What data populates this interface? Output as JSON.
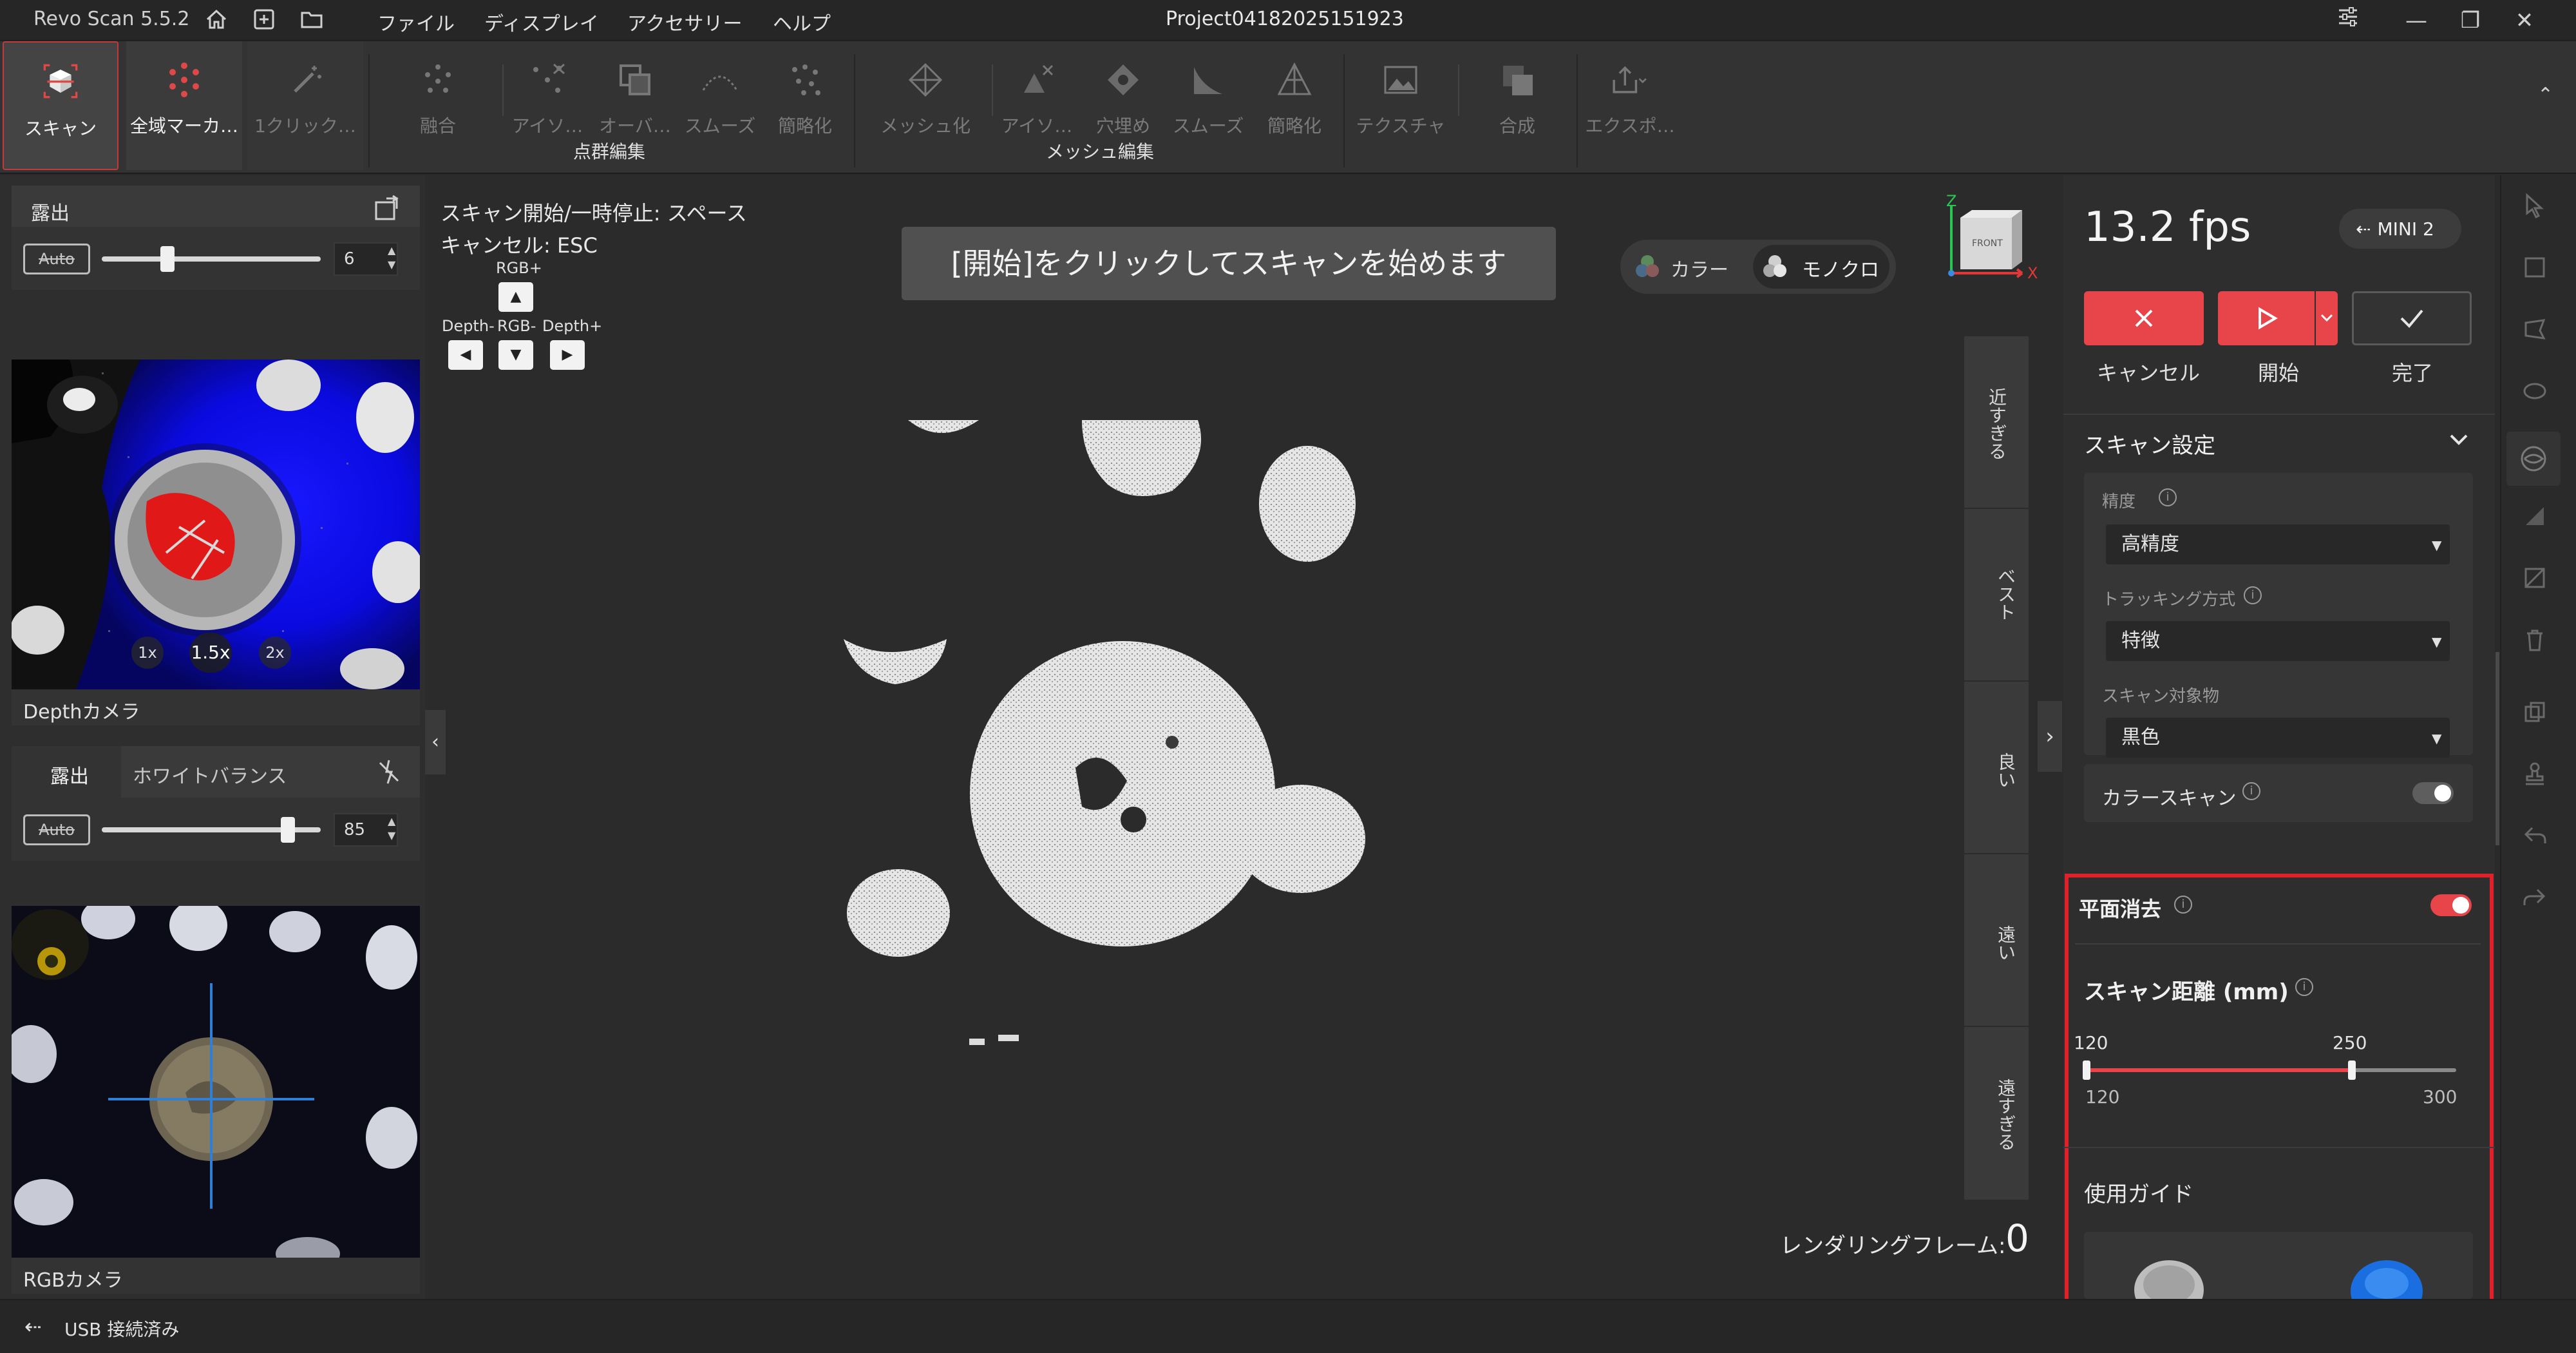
{
  "app": {
    "title": "Revo Scan 5.5.2",
    "project": "Project04182025151923"
  },
  "menu": [
    "ファイル",
    "ディスプレイ",
    "アクセサリー",
    "ヘルプ"
  ],
  "toolbar": {
    "scan": "スキャン",
    "global_marker": "全域マーカ…",
    "one_click": "1クリック…",
    "fuse": "融合",
    "isolate1": "アイソ…",
    "overlap": "オーバ…",
    "smooth1": "スムーズ",
    "simplify1": "簡略化",
    "mesh": "メッシュ化",
    "isolate2": "アイソ…",
    "fill": "穴埋め",
    "smooth2": "スムーズ",
    "simplify2": "簡略化",
    "texture": "テクスチャ",
    "merge": "合成",
    "export": "エクスポ…",
    "group_pointcloud": "点群編集",
    "group_mesh": "メッシュ編集"
  },
  "left": {
    "exposure_title": "露出",
    "auto": "Auto",
    "depth_exposure": "6",
    "depth_exposure_level": 0.3,
    "depth_camera": "Depthカメラ",
    "zoom": [
      "1x",
      "1.5x",
      "2x"
    ],
    "tab_exposure": "露出",
    "tab_wb": "ホワイトバランス",
    "rgb_exposure": "85",
    "rgb_exposure_level": 0.85,
    "rgb_camera": "RGBカメラ"
  },
  "viewport": {
    "hint_line1": "スキャン開始/一時停止: スペース",
    "hint_line2": "キャンセル: ESC",
    "rgb_plus": "RGB+",
    "depth_minus": "Depth-",
    "rgb_minus": "RGB-",
    "depth_plus": "Depth+",
    "banner": "[開始]をクリックしてスキャンを始めます",
    "color_mode": "カラー",
    "mono_mode": "モノクロ",
    "axis_z": "Z",
    "axis_x": "X",
    "cube_face": "FRONT",
    "distance_labels": [
      "近すぎる",
      "ベスト",
      "良い",
      "遠い",
      "遠すぎる"
    ],
    "render_label": "レンダリングフレーム:",
    "render_value": "0"
  },
  "right": {
    "fps": "13.2 fps",
    "device": "MINI 2",
    "cancel": "キャンセル",
    "start": "開始",
    "done": "完了",
    "scan_settings": "スキャン設定",
    "precision_label": "精度",
    "precision_value": "高精度",
    "tracking_label": "トラッキング方式",
    "tracking_value": "特徴",
    "object_label": "スキャン対象物",
    "object_value": "黒色",
    "color_scan": "カラースキャン",
    "color_scan_on": false,
    "plane_removal": "平面消去",
    "plane_removal_on": true,
    "scan_distance": "スキャン距離 (mm)",
    "dist_low": "120",
    "dist_high": "250",
    "range_min": "120",
    "range_max": "300",
    "guide": "使用ガイド"
  },
  "colors": {
    "accent_red": "#e8454a",
    "highlight_box": "#e0202a",
    "bg": "#2b2b2b"
  },
  "status": {
    "usb": "USB 接続済み"
  }
}
